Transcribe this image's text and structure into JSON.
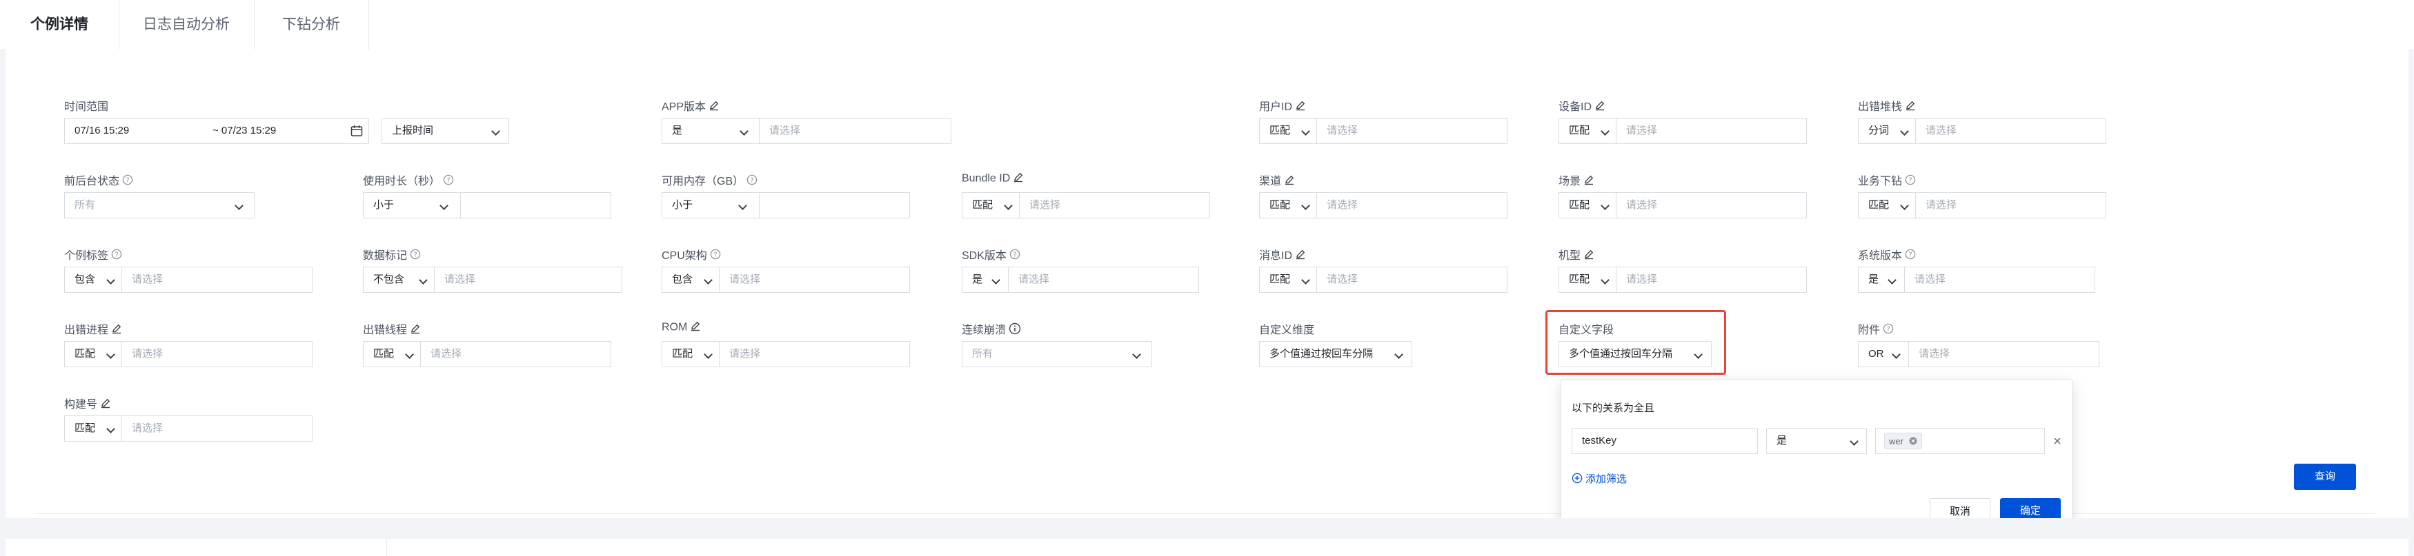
{
  "tabs": [
    "个例详情",
    "日志自动分析",
    "下钻分析"
  ],
  "rows": [
    [
      {
        "label": "时间范围",
        "icon": "",
        "type": "date",
        "start": "07/16 15:29",
        "end": "~ 07/23 15:29",
        "extra": "上报时间"
      },
      {
        "label": "APP版本",
        "icon": "edit",
        "type": "op",
        "op": "是",
        "placeholder": "请选择"
      },
      {
        "label": "用户ID",
        "icon": "edit",
        "type": "op",
        "op": "匹配",
        "placeholder": "请选择"
      },
      {
        "label": "设备ID",
        "icon": "edit",
        "type": "op",
        "op": "匹配",
        "placeholder": "请选择"
      },
      {
        "label": "出错堆栈",
        "icon": "edit",
        "type": "op",
        "op": "分词",
        "placeholder": "请选择"
      }
    ],
    [
      {
        "label": "前后台状态",
        "icon": "help",
        "type": "select",
        "value": "所有"
      },
      {
        "label": "使用时长（秒）",
        "icon": "help",
        "type": "op",
        "op": "小于",
        "placeholder": ""
      },
      {
        "label": "可用内存（GB）",
        "icon": "help",
        "type": "op",
        "op": "小于",
        "placeholder": ""
      },
      {
        "label": "Bundle ID",
        "icon": "edit",
        "type": "op",
        "op": "匹配",
        "placeholder": "请选择"
      },
      {
        "label": "渠道",
        "icon": "edit",
        "type": "op",
        "op": "匹配",
        "placeholder": "请选择"
      },
      {
        "label": "场景",
        "icon": "edit",
        "type": "op",
        "op": "匹配",
        "placeholder": "请选择"
      },
      {
        "label": "业务下钻",
        "icon": "help",
        "type": "op",
        "op": "匹配",
        "placeholder": "请选择"
      }
    ],
    [
      {
        "label": "个例标签",
        "icon": "help",
        "type": "op",
        "op": "包含",
        "placeholder": "请选择"
      },
      {
        "label": "数据标记",
        "icon": "help",
        "type": "op",
        "op": "不包含",
        "placeholder": "请选择"
      },
      {
        "label": "CPU架构",
        "icon": "help",
        "type": "op",
        "op": "包含",
        "placeholder": "请选择"
      },
      {
        "label": "SDK版本",
        "icon": "help",
        "type": "op",
        "op": "是",
        "placeholder": "请选择"
      },
      {
        "label": "消息ID",
        "icon": "edit",
        "type": "op",
        "op": "匹配",
        "placeholder": "请选择"
      },
      {
        "label": "机型",
        "icon": "edit",
        "type": "op",
        "op": "匹配",
        "placeholder": "请选择"
      },
      {
        "label": "系统版本",
        "icon": "help",
        "type": "op",
        "op": "是",
        "placeholder": "请选择"
      }
    ],
    [
      {
        "label": "出错进程",
        "icon": "edit",
        "type": "op",
        "op": "匹配",
        "placeholder": "请选择"
      },
      {
        "label": "出错线程",
        "icon": "edit",
        "type": "op",
        "op": "匹配",
        "placeholder": "请选择"
      },
      {
        "label": "ROM",
        "icon": "edit",
        "type": "op",
        "op": "匹配",
        "placeholder": "请选择"
      },
      {
        "label": "连续崩溃",
        "icon": "info",
        "type": "select",
        "value": "所有"
      },
      {
        "label": "自定义维度",
        "icon": "",
        "type": "select",
        "value": "多个值通过按回车分隔"
      },
      {
        "label": "自定义字段",
        "icon": "",
        "type": "select",
        "value": "多个值通过按回车分隔"
      },
      {
        "label": "附件",
        "icon": "help",
        "type": "op",
        "op": "OR",
        "placeholder": "请选择"
      }
    ],
    [
      {
        "label": "构建号",
        "icon": "edit",
        "type": "op",
        "op": "匹配",
        "placeholder": "请选择"
      }
    ]
  ],
  "popup": {
    "title": "以下的关系为全且",
    "key_value": "testKey",
    "op": "是",
    "tag": "wer",
    "add_label": "添加筛选",
    "cancel": "取消",
    "confirm": "确定"
  },
  "query_button": "查询",
  "colors": {
    "primary": "#0052d9",
    "highlight": "#e5463a"
  }
}
